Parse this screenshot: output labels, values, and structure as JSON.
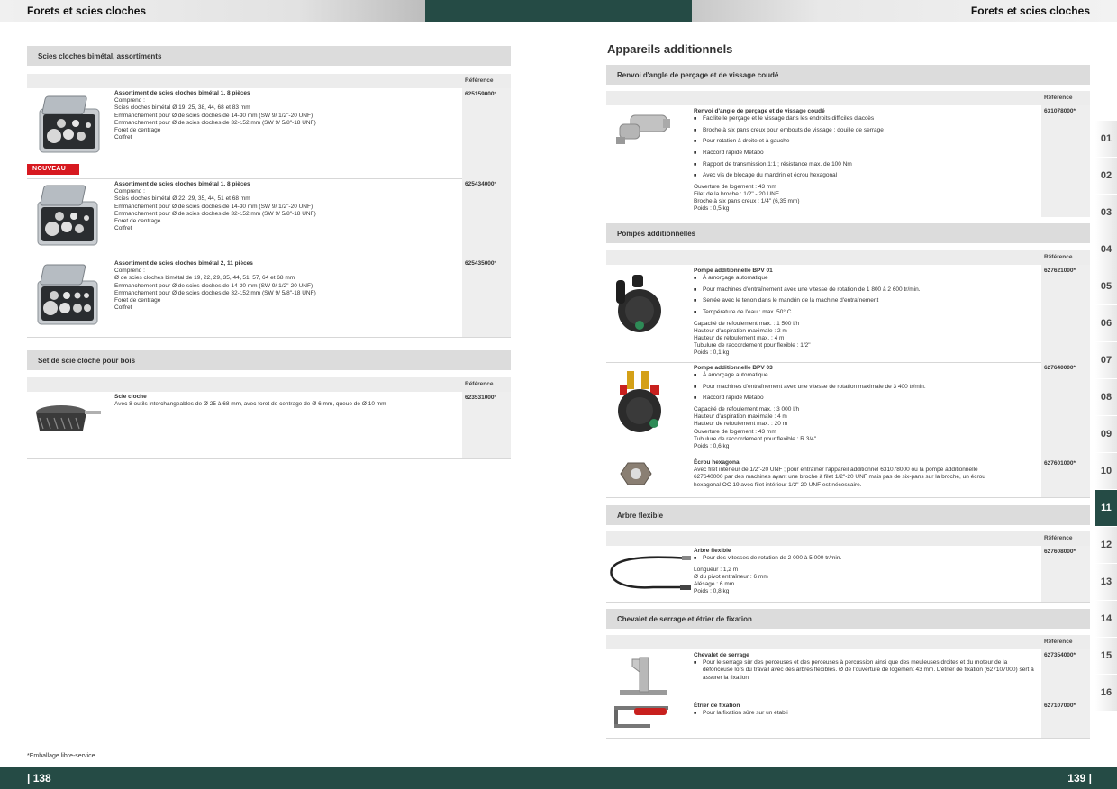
{
  "header": {
    "left_title": "Forets et scies cloches",
    "right_title": "Forets et scies cloches"
  },
  "footer": {
    "left_page": "| 138",
    "right_page": "139 |",
    "footnote": "*Emballage libre-service"
  },
  "ref_label": "Référence",
  "left": {
    "sections": [
      {
        "title": "Scies cloches bimétal, assortiments",
        "products": [
          {
            "name": "Assortiment de scies cloches bimétal 1, 8 pièces",
            "lines": [
              "Comprend :",
              "Scies cloches bimétal Ø 19, 25, 38, 44, 68 et 83 mm",
              "Emmanchement pour Ø de scies cloches de 14-30 mm (SW 9/ 1/2\"-20 UNF)",
              "Emmanchement pour Ø de scies cloches de 32-152 mm (SW 9/ 5/8\"-18 UNF)",
              "Foret de centrage",
              "Coffret"
            ],
            "ref": "625159000*",
            "badge": "NOUVEAU"
          },
          {
            "name": "Assortiment de scies cloches bimétal 1, 8 pièces",
            "lines": [
              "Comprend :",
              "Scies cloches bimétal Ø 22, 29, 35, 44, 51 et 68 mm",
              "Emmanchement pour Ø de scies cloches de 14-30 mm (SW 9/ 1/2\"-20 UNF)",
              "Emmanchement pour Ø de scies cloches de 32-152 mm (SW 9/ 5/8\"-18 UNF)",
              "Foret de centrage",
              "Coffret"
            ],
            "ref": "625434000*"
          },
          {
            "name": "Assortiment de scies cloches bimétal 2, 11 pièces",
            "lines": [
              "Comprend :",
              "Ø de scies cloches bimétal de 19, 22, 29, 35, 44, 51, 57, 64 et 68 mm",
              "Emmanchement pour Ø de scies cloches de 14-30 mm (SW 9/ 1/2\"-20 UNF)",
              "Emmanchement pour Ø de scies cloches de 32-152 mm (SW 9/ 5/8\"-18 UNF)",
              "Foret de centrage",
              "Coffret"
            ],
            "ref": "625435000*"
          }
        ]
      },
      {
        "title": "Set de scie cloche pour bois",
        "products": [
          {
            "name": "Scie cloche",
            "lines": [
              "Avec 8 outils interchangeables de Ø 25 à 68 mm, avec foret de centrage de Ø 6 mm, queue de Ø 10 mm"
            ],
            "ref": "623531000*"
          }
        ]
      }
    ]
  },
  "right": {
    "heading": "Appareils additionnels",
    "sections": [
      {
        "title": "Renvoi d'angle de perçage et de vissage coudé",
        "products": [
          {
            "name": "Renvoi d'angle de perçage et de vissage coudé",
            "bullets": [
              "Facilite le perçage et le vissage dans les endroits difficiles d'accès",
              "Broche à six pans creux pour embouts de vissage ; douille de serrage",
              "Pour rotation à droite et à gauche",
              "Raccord rapide Metabo",
              "Rapport de transmission 1:1 ; résistance max. de 100 Nm",
              "Avec vis de blocage du mandrin et écrou hexagonal"
            ],
            "specs": [
              "Ouverture de logement : 43 mm",
              "Filet de la broche : 1/2\" - 20 UNF",
              "Broche à six pans creux : 1/4\" (6,35 mm)",
              "Poids : 0,5 kg"
            ],
            "ref": "631078000*"
          }
        ]
      },
      {
        "title": "Pompes additionnelles",
        "products": [
          {
            "name": "Pompe additionnelle BPV 01",
            "bullets": [
              "À amorçage automatique",
              "Pour machines d'entraînement avec une vitesse de rotation de 1 800 à 2 600 tr/min.",
              "Serrée avec le tenon dans le mandrin de la machine d'entraînement",
              "Température de l'eau : max. 50° C"
            ],
            "specs": [
              "Capacité de refoulement max. : 1 500 l/h",
              "Hauteur d'aspiration maximale : 2 m",
              "Hauteur de refoulement max. : 4 m",
              "Tubulure de raccordement pour flexible : 1/2\"",
              "Poids : 0,1 kg"
            ],
            "ref": "627621000*"
          },
          {
            "name": "Pompe additionnelle BPV 03",
            "bullets": [
              "À amorçage automatique",
              "Pour machines d'entraînement avec une vitesse de rotation maximale de 3 400 tr/min.",
              "Raccord rapide Metabo"
            ],
            "specs": [
              "Capacité de refoulement max. : 3 000 l/h",
              "Hauteur d'aspiration maximale : 4 m",
              "Hauteur de refoulement max. : 20 m",
              "Ouverture de logement : 43 mm",
              "Tubulure de raccordement pour flexible : R 3/4\"",
              "Poids : 0,6 kg"
            ],
            "ref": "627640000*"
          },
          {
            "name": "Écrou hexagonal",
            "bullets": [],
            "specs": [
              "Avec filet intérieur de 1/2\"-20 UNF ; pour entraîner l'appareil additionnel 631078000 ou la pompe additionnelle",
              "627640000 par des machines ayant une broche à filet 1/2\"-20 UNF mais pas de six-pans sur la broche, un écrou",
              "hexagonal OC 19 avec filet intérieur 1/2\"-20 UNF est nécessaire."
            ],
            "ref": "627601000*"
          }
        ]
      },
      {
        "title": "Arbre flexible",
        "products": [
          {
            "name": "Arbre flexible",
            "bullets": [
              "Pour des vitesses de rotation de 2 000 à 5 000 tr/min."
            ],
            "specs": [
              "Longueur : 1,2 m",
              "Ø du pivot entraîneur : 6 mm",
              "Alésage : 6 mm",
              "Poids : 0,8 kg"
            ],
            "ref": "627608000*"
          }
        ]
      },
      {
        "title": "Chevalet de serrage et étrier de fixation",
        "products": [
          {
            "name": "Chevalet de serrage",
            "bullets": [
              "Pour le serrage sûr des perceuses et des perceuses à percussion ainsi que des meuleuses droites et du moteur de la défonceuse lors du travail avec des arbres flexibles. Ø de l'ouverture de logement 43 mm. L'étrier de fixation (627107000) sert à assurer la fixation"
            ],
            "specs": [],
            "ref": "627354000*"
          },
          {
            "name": "Étrier de fixation",
            "bullets": [
              "Pour la fixation sûre sur un établi"
            ],
            "specs": [],
            "ref": "627107000*"
          }
        ]
      }
    ]
  },
  "tabs": [
    "01",
    "02",
    "03",
    "04",
    "05",
    "06",
    "07",
    "08",
    "09",
    "10",
    "11",
    "12",
    "13",
    "14",
    "15",
    "16"
  ],
  "active_tab": "11",
  "colors": {
    "dark_green": "#254b45",
    "badge_red": "#d71920",
    "section_grey": "#dcdcdc"
  },
  "icons": [
    "hole-saw-kit-case-image",
    "hole-saw-wood-image",
    "angle-drive-image",
    "pump-bpv01-image",
    "pump-bpv03-image",
    "hex-nut-image",
    "flexible-shaft-image",
    "clamping-stand-image",
    "fixing-clamp-image"
  ]
}
